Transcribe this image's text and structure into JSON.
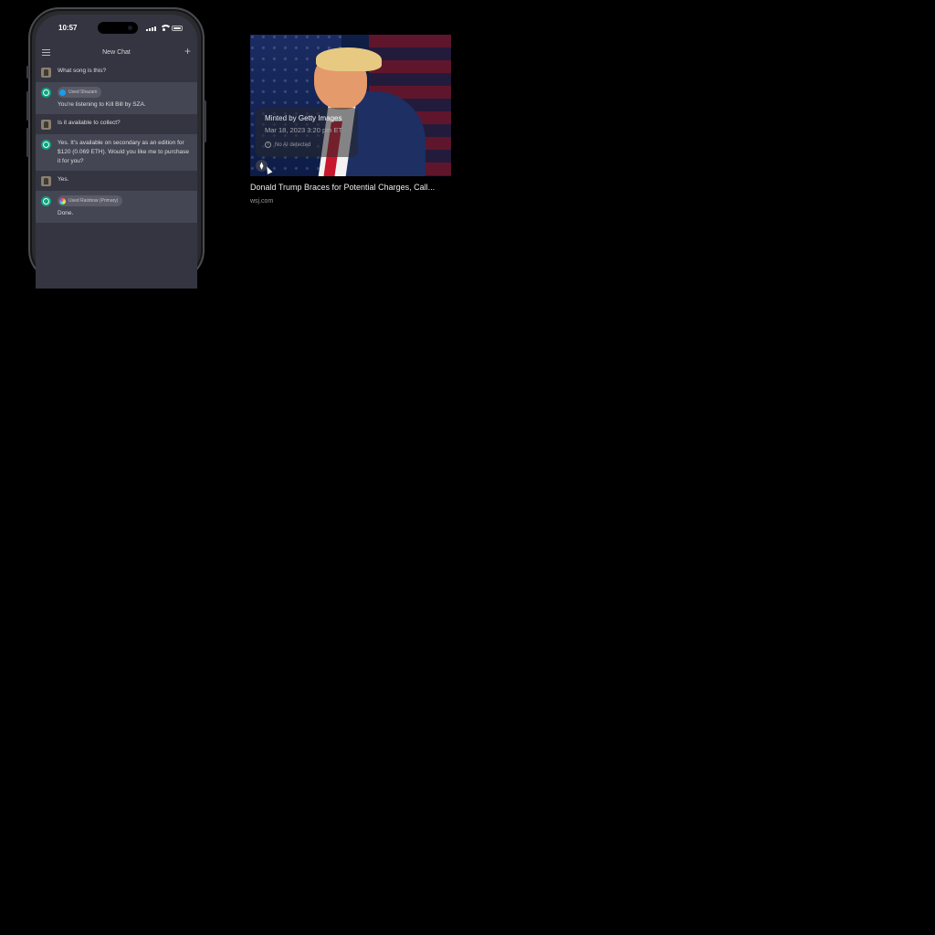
{
  "phone": {
    "status_time": "10:57",
    "nav_title": "New Chat",
    "messages": [
      {
        "role": "user",
        "text": "What song is this?"
      },
      {
        "role": "assistant",
        "plugin": "Used Shazam",
        "text": "You're listening to Kill Bill by SZA."
      },
      {
        "role": "user",
        "text": "Is it available to collect?"
      },
      {
        "role": "assistant",
        "text": "Yes. It's available on secondary as an edition for $120 (0.069 ETH). Would you like me to purchase it for you?"
      },
      {
        "role": "user",
        "text": "Yes."
      },
      {
        "role": "assistant",
        "plugin": "Used Rainbow (Primary)",
        "text": "Done."
      }
    ]
  },
  "card": {
    "minted_prefix": "Minted by",
    "minted_by": "Getty Images",
    "minted_date": "Mar 18, 2023 3:20 pm ET",
    "ai_status": "No AI detected",
    "eth_symbol": "⧫",
    "title": "Donald Trump Braces for Potential Charges, Call...",
    "source": "wsj.com"
  },
  "colors": {
    "background": "#000000",
    "assistant_row": "#444654",
    "user_row": "#343541",
    "bot_avatar": "#10a37f"
  }
}
